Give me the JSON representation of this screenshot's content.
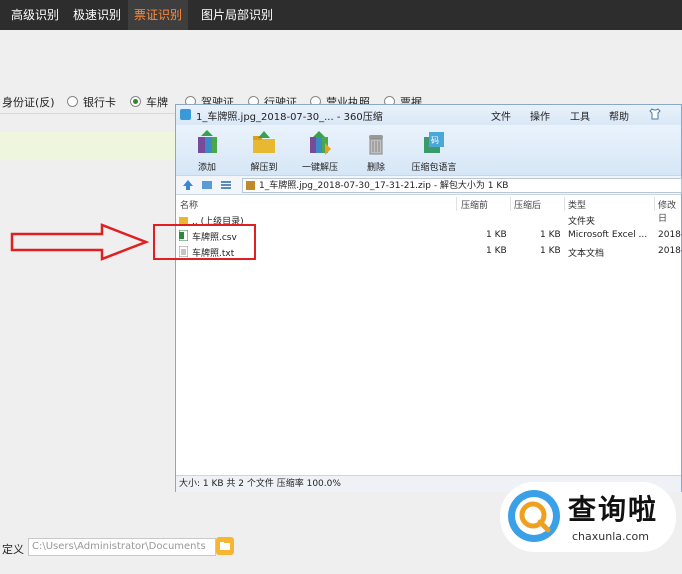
{
  "top_tabs": [
    "高级识别",
    "极速识别",
    "票证识别",
    "图片局部识别"
  ],
  "active_tab_index": 2,
  "radio_options": [
    {
      "label": "身份证(反)",
      "selected": false
    },
    {
      "label": "银行卡",
      "selected": false
    },
    {
      "label": "车牌",
      "selected": true
    },
    {
      "label": "驾驶证",
      "selected": false
    },
    {
      "label": "行驶证",
      "selected": false
    },
    {
      "label": "营业执照",
      "selected": false
    },
    {
      "label": "票据",
      "selected": false
    }
  ],
  "bottom": {
    "label": "定义",
    "path_value": "C:\\Users\\Administrator\\Documents"
  },
  "archive_window": {
    "title": "1_车牌照.jpg_2018-07-30_... - 360压缩",
    "menu": [
      "文件",
      "操作",
      "工具",
      "帮助"
    ],
    "toolbar": [
      {
        "label": "添加",
        "icon": "add-books-icon"
      },
      {
        "label": "解压到",
        "icon": "extract-folder-icon"
      },
      {
        "label": "一键解压",
        "icon": "one-click-extract-icon"
      },
      {
        "label": "删除",
        "icon": "trash-bin-icon"
      },
      {
        "label": "压缩包语言",
        "icon": "archive-language-icon"
      }
    ],
    "address": "1_车牌照.jpg_2018-07-30_17-31-21.zip - 解包大小为 1 KB",
    "columns": [
      "名称",
      "压缩前",
      "压缩后",
      "类型",
      "修改日"
    ],
    "rows": [
      {
        "name": ".. (上级目录)",
        "before": "",
        "after": "",
        "type": "文件夹",
        "modified": "",
        "icon": "folder-up-icon"
      },
      {
        "name": "车牌照.csv",
        "before": "1 KB",
        "after": "1 KB",
        "type": "Microsoft Excel ...",
        "modified": "2018-",
        "icon": "excel-file-icon"
      },
      {
        "name": "车牌照.txt",
        "before": "1 KB",
        "after": "1 KB",
        "type": "文本文档",
        "modified": "2018-",
        "icon": "text-file-icon"
      }
    ],
    "status": "大小: 1 KB 共 2 个文件 压缩率 100.0%"
  },
  "watermark": {
    "zh": "查询啦",
    "en": "chaxunla.com"
  },
  "colors": {
    "active_tab": "#ff8a3d",
    "annotation_red": "#e02020",
    "topbar_bg": "#2d2d2d"
  }
}
